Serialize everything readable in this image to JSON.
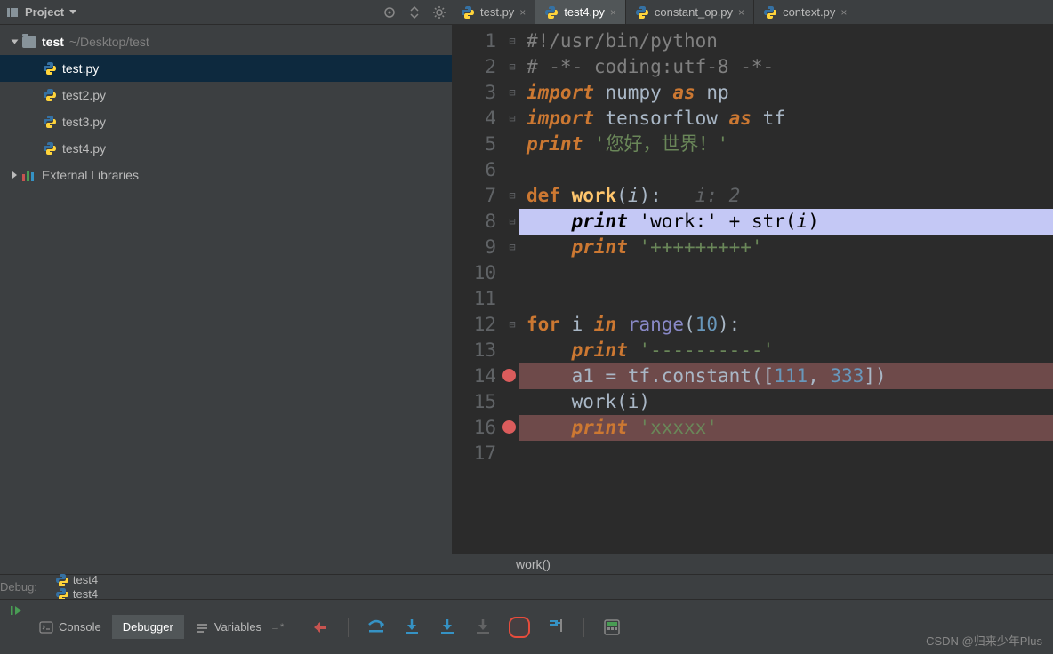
{
  "sidebar": {
    "header_label": "Project",
    "root": {
      "name": "test",
      "path": "~/Desktop/test"
    },
    "files": [
      "test.py",
      "test2.py",
      "test3.py",
      "test4.py"
    ],
    "external_libs_label": "External Libraries"
  },
  "tabs": [
    {
      "label": "test.py",
      "active": false
    },
    {
      "label": "test4.py",
      "active": true
    },
    {
      "label": "constant_op.py",
      "active": false
    },
    {
      "label": "context.py",
      "active": false
    }
  ],
  "code": {
    "lines": [
      {
        "n": 1,
        "tokens": [
          [
            "comment",
            "#!/usr/bin/python"
          ]
        ]
      },
      {
        "n": 2,
        "tokens": [
          [
            "comment",
            "# -*- coding:utf-8 -*-"
          ]
        ]
      },
      {
        "n": 3,
        "tokens": [
          [
            "keyword",
            "import"
          ],
          [
            "sp",
            " "
          ],
          [
            "ident",
            "numpy"
          ],
          [
            "sp",
            " "
          ],
          [
            "keyword",
            "as"
          ],
          [
            "sp",
            " "
          ],
          [
            "ident",
            "np"
          ]
        ]
      },
      {
        "n": 4,
        "tokens": [
          [
            "keyword",
            "import"
          ],
          [
            "sp",
            " "
          ],
          [
            "ident",
            "tensorflow"
          ],
          [
            "sp",
            " "
          ],
          [
            "keyword",
            "as"
          ],
          [
            "sp",
            " "
          ],
          [
            "ident",
            "tf"
          ]
        ]
      },
      {
        "n": 5,
        "tokens": [
          [
            "keyword",
            "print"
          ],
          [
            "sp",
            " "
          ],
          [
            "str",
            "'您好，世界！'"
          ]
        ]
      },
      {
        "n": 6,
        "tokens": []
      },
      {
        "n": 7,
        "tokens": [
          [
            "kw2",
            "def"
          ],
          [
            "sp",
            " "
          ],
          [
            "func",
            "work"
          ],
          [
            "op",
            "("
          ],
          [
            "param",
            "i"
          ],
          [
            "op",
            "):"
          ],
          [
            "sp",
            "   "
          ],
          [
            "hint",
            "i: 2"
          ]
        ]
      },
      {
        "n": 8,
        "current": true,
        "tokens": [
          [
            "indent",
            "    "
          ],
          [
            "keyword",
            "print"
          ],
          [
            "sp",
            " "
          ],
          [
            "str",
            "'work:'"
          ],
          [
            "sp",
            " "
          ],
          [
            "op",
            "+"
          ],
          [
            "sp",
            " "
          ],
          [
            "builtin",
            "str"
          ],
          [
            "op",
            "("
          ],
          [
            "param",
            "i"
          ],
          [
            "op",
            ")"
          ]
        ]
      },
      {
        "n": 9,
        "tokens": [
          [
            "indent",
            "    "
          ],
          [
            "keyword",
            "print"
          ],
          [
            "sp",
            " "
          ],
          [
            "str",
            "'+++++++++'"
          ]
        ]
      },
      {
        "n": 10,
        "tokens": []
      },
      {
        "n": 11,
        "tokens": []
      },
      {
        "n": 12,
        "tokens": [
          [
            "kw2",
            "for"
          ],
          [
            "sp",
            " "
          ],
          [
            "ident",
            "i"
          ],
          [
            "sp",
            " "
          ],
          [
            "keyword",
            "in"
          ],
          [
            "sp",
            " "
          ],
          [
            "builtin",
            "range"
          ],
          [
            "op",
            "("
          ],
          [
            "num",
            "10"
          ],
          [
            "op",
            "):"
          ]
        ]
      },
      {
        "n": 13,
        "tokens": [
          [
            "indent",
            "    "
          ],
          [
            "keyword",
            "print"
          ],
          [
            "sp",
            " "
          ],
          [
            "str",
            "'----------'"
          ]
        ]
      },
      {
        "n": 14,
        "bp": true,
        "tokens": [
          [
            "indent",
            "    "
          ],
          [
            "ident",
            "a1"
          ],
          [
            "sp",
            " "
          ],
          [
            "op",
            "="
          ],
          [
            "sp",
            " "
          ],
          [
            "ident",
            "tf.constant"
          ],
          [
            "op",
            "(["
          ],
          [
            "num",
            "111"
          ],
          [
            "op",
            ", "
          ],
          [
            "num",
            "333"
          ],
          [
            "op",
            "])"
          ]
        ]
      },
      {
        "n": 15,
        "tokens": [
          [
            "indent",
            "    "
          ],
          [
            "ident",
            "work(i)"
          ]
        ]
      },
      {
        "n": 16,
        "bp": true,
        "tokens": [
          [
            "indent",
            "    "
          ],
          [
            "keyword",
            "print"
          ],
          [
            "sp",
            " "
          ],
          [
            "str",
            "'xxxxx'"
          ]
        ]
      },
      {
        "n": 17,
        "tokens": []
      }
    ]
  },
  "breadcrumb": "work()",
  "debug": {
    "label": "Debug:",
    "sessions": [
      "test4",
      "test4"
    ],
    "tabs": {
      "console": "Console",
      "debugger": "Debugger",
      "variables": "Variables"
    }
  },
  "watermark": "CSDN @归来少年Plus"
}
